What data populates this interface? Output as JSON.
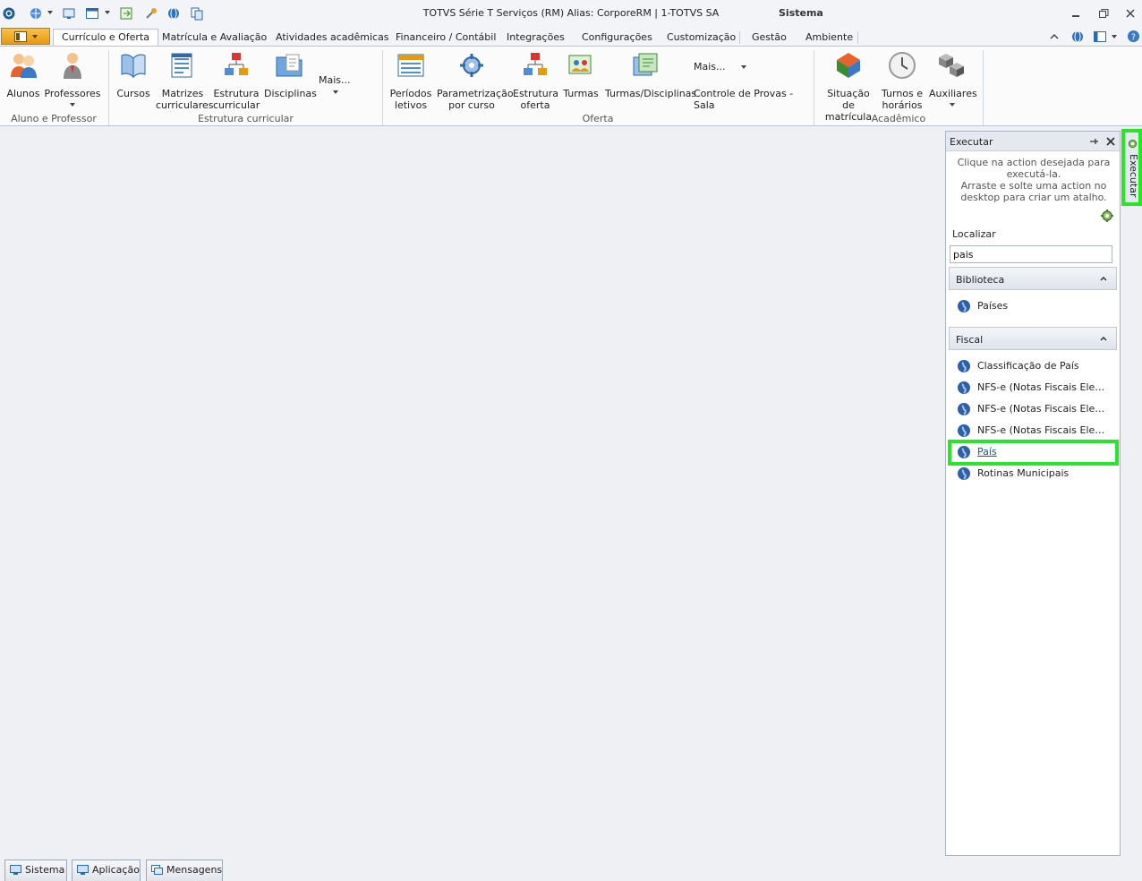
{
  "window": {
    "title": "TOTVS Série T Serviços (RM) Alias: CorporeRM | 1-TOTVS SA",
    "context_title": "Sistema"
  },
  "tabs": [
    {
      "label": "Currículo e Oferta",
      "active": true
    },
    {
      "label": "Matrícula e Avaliação"
    },
    {
      "label": "Atividades acadêmicas"
    },
    {
      "label": "Financeiro / Contábil"
    },
    {
      "label": "Integrações"
    },
    {
      "label": "Configurações"
    },
    {
      "label": "Customização"
    },
    {
      "label": "Gestão"
    },
    {
      "label": "Ambiente"
    }
  ],
  "ribbon": {
    "groups": {
      "aluno_professor": "Aluno e Professor",
      "estrutura": "Estrutura curricular",
      "oferta": "Oferta",
      "academico": "Acadêmico"
    },
    "buttons": {
      "alunos": "Alunos",
      "professores": "Professores",
      "cursos": "Cursos",
      "matrizes": "Matrizes\ncurriculares",
      "estrutura_curricular": "Estrutura\ncurricular",
      "disciplinas": "Disciplinas",
      "mais1": "Mais...",
      "periodos": "Períodos\nletivos",
      "parametrizacao": "Parametrização\npor curso",
      "estrutura_oferta": "Estrutura\noferta",
      "turmas": "Turmas",
      "turmas_disciplinas": "Turmas/Disciplinas",
      "mais2": "Mais...",
      "controle_provas": "Controle de Provas - Sala",
      "situacao": "Situação de\nmatrícula",
      "turnos": "Turnos e\nhorários",
      "auxiliares": "Auxiliares"
    }
  },
  "panel": {
    "title": "Executar",
    "hint1": "Clique na action desejada para executá-la.",
    "hint2": "Arraste e solte uma action no desktop para criar um atalho.",
    "search_label": "Localizar",
    "search_value": "pais",
    "sections": {
      "biblioteca": {
        "title": "Biblioteca",
        "items": [
          "Países"
        ]
      },
      "fiscal": {
        "title": "Fiscal",
        "items": [
          "Classificação de País",
          "NFS-e (Notas Fiscais Eletrô...",
          "NFS-e (Notas Fiscais Eletrô...",
          "NFS-e (Notas Fiscais Eletrô...",
          "País",
          "Rotinas Municipais"
        ]
      }
    }
  },
  "right_strip": {
    "label": "Executar"
  },
  "bottom_tabs": [
    "Sistema",
    "Aplicação",
    "Mensagens"
  ],
  "colors": {
    "highlight": "#28e52a",
    "accent": "#e69a10",
    "link": "#1f4f9a"
  }
}
